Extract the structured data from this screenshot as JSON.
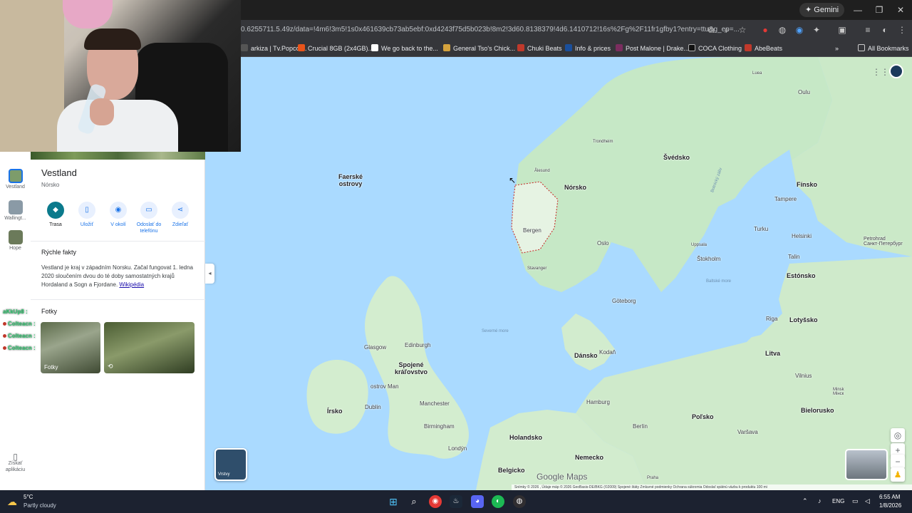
{
  "browser": {
    "gemini_label": "✦ Gemini",
    "url": "0.6255711.5.49z/data=!4m6!3m5!1s0x461639cb73ab5ebf:0xd4243f75d5b023b!8m2!3d60.8138379!4d6.1410712!16s%2Fg%2F11fr1gfby1?entry=ttu&g_ep=...",
    "window_controls": [
      "—",
      "❐",
      "✕"
    ],
    "bookmarks": [
      {
        "label": "arkiza | Tv.Popcor...",
        "color": "#555"
      },
      {
        "label": "Crucial 8GB (2x4GB)...",
        "color": "#e8541a"
      },
      {
        "label": "We go back to the...",
        "color": "#fff"
      },
      {
        "label": "General Tso's Chick...",
        "color": "#d4a23d"
      },
      {
        "label": "Chuki Beats",
        "color": "#c0392b"
      },
      {
        "label": "Info & prices",
        "color": "#1a4f9c"
      },
      {
        "label": "Post Malone | Drake...",
        "color": "#7b2d5f"
      },
      {
        "label": "COCA Clothing",
        "color": "#111"
      },
      {
        "label": "AbeBeats",
        "color": "#c0392b"
      }
    ],
    "all_bookmarks": "All Bookmarks",
    "overflow": "»"
  },
  "rail": {
    "items": [
      {
        "label": "Vestland"
      },
      {
        "label": "Wallingt..."
      },
      {
        "label": "Hope"
      }
    ],
    "get_app": "Získať aplikáciu"
  },
  "place": {
    "title": "Vestland",
    "subtitle": "Nórsko",
    "actions": [
      {
        "label": "Trasa",
        "icon": "◆"
      },
      {
        "label": "Uložiť",
        "icon": "▯"
      },
      {
        "label": "V okolí",
        "icon": "◉"
      },
      {
        "label": "Odoslať do telefónu",
        "icon": "▭"
      },
      {
        "label": "Zdieľať",
        "icon": "⋖"
      }
    ],
    "facts_title": "Rýchle fakty",
    "facts_text": "Vestland je kraj v západním Norsku. Začal fungovat 1. ledna 2020 sloučením dvou do té doby samostatných krajů Hordaland a Sogn a Fjordane.",
    "facts_link": "Wikipédia",
    "photos_title": "Fotky",
    "photo1_label": "Fotky",
    "photo2_icon": "⟲"
  },
  "chat": [
    {
      "user": "aKkUp8 :"
    },
    {
      "user": "Colteacn :"
    },
    {
      "user": "Colteacn :"
    },
    {
      "user": "Colteacn :"
    }
  ],
  "map": {
    "labels": [
      {
        "text": "Faerské\nostrovy",
        "kind": "country"
      },
      {
        "text": "Nórsko",
        "kind": "country"
      },
      {
        "text": "Švédsko",
        "kind": "country"
      },
      {
        "text": "Fínsko",
        "kind": "country"
      },
      {
        "text": "Estónsko",
        "kind": "country"
      },
      {
        "text": "Lotyšsko",
        "kind": "country"
      },
      {
        "text": "Litva",
        "kind": "country"
      },
      {
        "text": "Dánsko",
        "kind": "country"
      },
      {
        "text": "Spojené\nkráľovstvo",
        "kind": "country"
      },
      {
        "text": "Írsko",
        "kind": "country"
      },
      {
        "text": "Holandsko",
        "kind": "country"
      },
      {
        "text": "Nemecko",
        "kind": "country"
      },
      {
        "text": "Poľsko",
        "kind": "country"
      },
      {
        "text": "Bielorusko",
        "kind": "country"
      },
      {
        "text": "Belgicko",
        "kind": "country"
      },
      {
        "text": "Trondheim",
        "kind": "small"
      },
      {
        "text": "Ålesund",
        "kind": "small"
      },
      {
        "text": "Bergen",
        "kind": "city"
      },
      {
        "text": "Stavanger",
        "kind": "small"
      },
      {
        "text": "Oslo",
        "kind": "city"
      },
      {
        "text": "Uppsala",
        "kind": "small"
      },
      {
        "text": "Štokholm",
        "kind": "city"
      },
      {
        "text": "Göteborg",
        "kind": "city"
      },
      {
        "text": "Kodaň",
        "kind": "city"
      },
      {
        "text": "Oulu",
        "kind": "city"
      },
      {
        "text": "Luea",
        "kind": "small"
      },
      {
        "text": "Tampere",
        "kind": "city"
      },
      {
        "text": "Turku",
        "kind": "city"
      },
      {
        "text": "Helsinki",
        "kind": "city"
      },
      {
        "text": "Talin",
        "kind": "city"
      },
      {
        "text": "Petrohrad\nСанкт-Петербург",
        "kind": "city"
      },
      {
        "text": "Riga",
        "kind": "city"
      },
      {
        "text": "Vilnius",
        "kind": "city"
      },
      {
        "text": "Minsk\nМінск",
        "kind": "small"
      },
      {
        "text": "Edinburgh",
        "kind": "city"
      },
      {
        "text": "Glasgow",
        "kind": "city"
      },
      {
        "text": "ostrov Man",
        "kind": "city"
      },
      {
        "text": "Dublin",
        "kind": "city"
      },
      {
        "text": "Manchester",
        "kind": "city"
      },
      {
        "text": "Birmingham",
        "kind": "city"
      },
      {
        "text": "Londýn",
        "kind": "city"
      },
      {
        "text": "Hamburg",
        "kind": "city"
      },
      {
        "text": "Berlín",
        "kind": "city"
      },
      {
        "text": "Varšava",
        "kind": "city"
      },
      {
        "text": "Praha",
        "kind": "small"
      },
      {
        "text": "Severné more",
        "kind": "sea"
      },
      {
        "text": "Baltské more",
        "kind": "sea"
      },
      {
        "text": "Botnický záliv",
        "kind": "sea"
      }
    ],
    "layers_label": "Vrstvy",
    "logo": "Google Maps",
    "footer": "Snímky © 2026 , Údaje máp © 2026 GeoBasis-DE/BKG (©2009)    Spojené štáty    Zmluvné podmienky    Ochrana súkromia    Odoslať spätnú väzbu k produktu    100 mi",
    "controls": [
      "◎",
      "+",
      "−"
    ]
  },
  "taskbar": {
    "temp": "5°C",
    "weather": "Partly cloudy",
    "lang": "ENG",
    "time": "6:55 AM",
    "date": "1/8/2026",
    "apps": [
      {
        "name": "start",
        "glyph": "⊞",
        "color": "#1e88e5"
      },
      {
        "name": "search",
        "glyph": "⌕",
        "color": "transparent"
      },
      {
        "name": "chrome",
        "glyph": "◉",
        "color": "#e53935"
      },
      {
        "name": "steam",
        "glyph": "♨",
        "color": "#1b2838"
      },
      {
        "name": "discord",
        "glyph": "◕",
        "color": "#5865f2"
      },
      {
        "name": "spotify",
        "glyph": "◐",
        "color": "#1db954"
      },
      {
        "name": "obs",
        "glyph": "◍",
        "color": "#302e31"
      }
    ]
  }
}
